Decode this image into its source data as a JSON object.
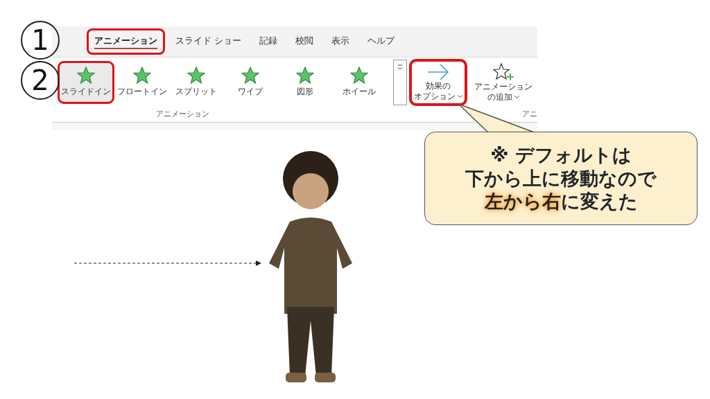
{
  "step_markers": [
    {
      "label": "1"
    },
    {
      "label": "2"
    }
  ],
  "tabs": [
    {
      "label": "アニメーション",
      "selected": true,
      "highlighted": true
    },
    {
      "label": "スライド ショー",
      "selected": false,
      "highlighted": false
    },
    {
      "label": "記録",
      "selected": false,
      "highlighted": false
    },
    {
      "label": "校閲",
      "selected": false,
      "highlighted": false
    },
    {
      "label": "表示",
      "selected": false,
      "highlighted": false
    },
    {
      "label": "ヘルプ",
      "selected": false,
      "highlighted": false
    }
  ],
  "animations": [
    {
      "label": "スライドイン",
      "selected": true,
      "highlighted": true
    },
    {
      "label": "フロートイン",
      "selected": false,
      "highlighted": false
    },
    {
      "label": "スプリット",
      "selected": false,
      "highlighted": false
    },
    {
      "label": "ワイプ",
      "selected": false,
      "highlighted": false
    },
    {
      "label": "図形",
      "selected": false,
      "highlighted": false
    },
    {
      "label": "ホイール",
      "selected": false,
      "highlighted": false
    }
  ],
  "effect_options": {
    "lines": [
      "効果の",
      "オプション"
    ],
    "highlighted": true
  },
  "add_animation": {
    "lines": [
      "アニメーション",
      "の追加"
    ]
  },
  "group_labels": [
    "アニメーション",
    "アニ"
  ],
  "callout": {
    "lines": [
      [
        {
          "text": "※ デフォルトは",
          "emphasis": false
        }
      ],
      [
        {
          "text": "下から上に移動なので",
          "emphasis": false
        }
      ],
      [
        {
          "text": "左から右",
          "emphasis": true
        },
        {
          "text": "に変えた",
          "emphasis": false
        }
      ]
    ]
  }
}
